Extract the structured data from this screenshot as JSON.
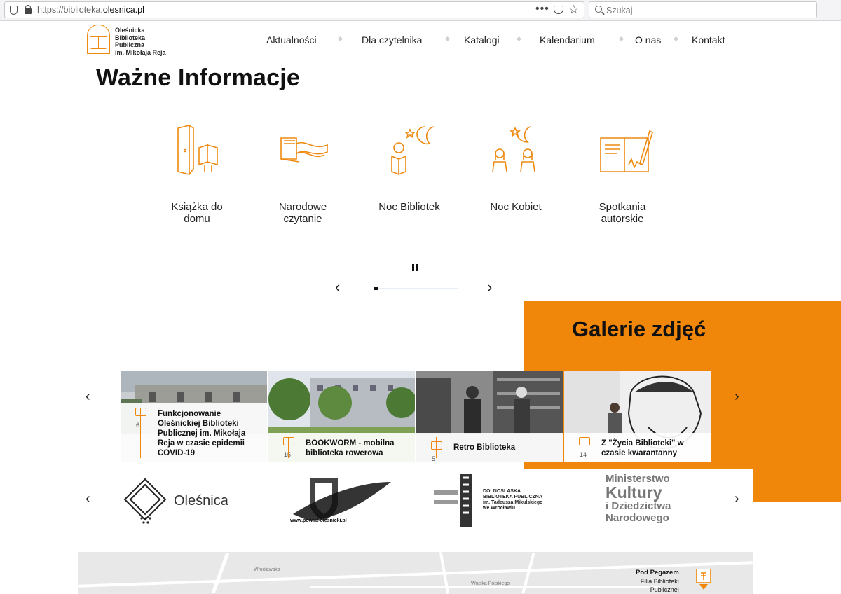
{
  "browser": {
    "url_prefix": "https://biblioteka.",
    "url_domain": "olesnica.pl",
    "menu_dots": "•••",
    "search_placeholder": "Szukaj"
  },
  "logo": {
    "line1": "Oleśnicka",
    "line2": "Biblioteka",
    "line3": "Publiczna",
    "line4": "im. Mikołaja Reja"
  },
  "nav": {
    "items": [
      "Aktualności",
      "Dla czytelnika",
      "Katalogi",
      "Kalendarium",
      "O nas",
      "Kontakt"
    ]
  },
  "info": {
    "title": "Ważne Informacje",
    "items": [
      {
        "label_1": "Książka do",
        "label_2": "domu",
        "icon": "door-book-icon"
      },
      {
        "label_1": "Narodowe",
        "label_2": "czytanie",
        "icon": "open-book-icon"
      },
      {
        "label_1": "Noc Bibliotek",
        "label_2": "",
        "icon": "night-reader-icon"
      },
      {
        "label_1": "Noc Kobiet",
        "label_2": "",
        "icon": "night-women-icon"
      },
      {
        "label_1": "Spotkania",
        "label_2": "autorskie",
        "icon": "signing-icon"
      }
    ],
    "progress": 0.05
  },
  "gallery": {
    "title": "Galerie zdjęć",
    "cards": [
      {
        "count": "6",
        "line1": "Funkcjonowanie",
        "line2": "Oleśnickiej Biblioteki",
        "line3": "Publicznej im. Mikołaja",
        "line4": "Reja w czasie epidemii",
        "line5": "COVID-19"
      },
      {
        "count": "15",
        "line1": "BOOKWORM - mobilna",
        "line2": "biblioteka rowerowa",
        "line3": "",
        "line4": "",
        "line5": ""
      },
      {
        "count": "5",
        "line1": "Retro Biblioteka",
        "line2": "",
        "line3": "",
        "line4": "",
        "line5": ""
      },
      {
        "count": "14",
        "line1": "Z \"Życia Biblioteki\" w",
        "line2": "czasie kwarantanny",
        "line3": "",
        "line4": "",
        "line5": ""
      }
    ]
  },
  "partners": {
    "olesnica": "Oleśnica",
    "powiat": "www.powiat-olesnicki.pl",
    "dbp_1": "DOLNOŚLĄSKA",
    "dbp_2": "BIBLIOTEKA PUBLICZNA",
    "dbp_3": "im. Tadeusza Mikulskiego",
    "dbp_4": "we Wrocławiu",
    "mk_1": "Ministerstwo",
    "mk_2": "Kultury",
    "mk_3": "i Dziedzictwa",
    "mk_4": "Narodowego"
  },
  "map": {
    "poi_1": "Pod Pegazem",
    "poi_2": "Filia Biblioteki",
    "poi_3": "Publicznej",
    "street_1": "Wrocławska",
    "street_2": "Wojska Polskiego"
  },
  "colors": {
    "accent": "#f0870a"
  }
}
